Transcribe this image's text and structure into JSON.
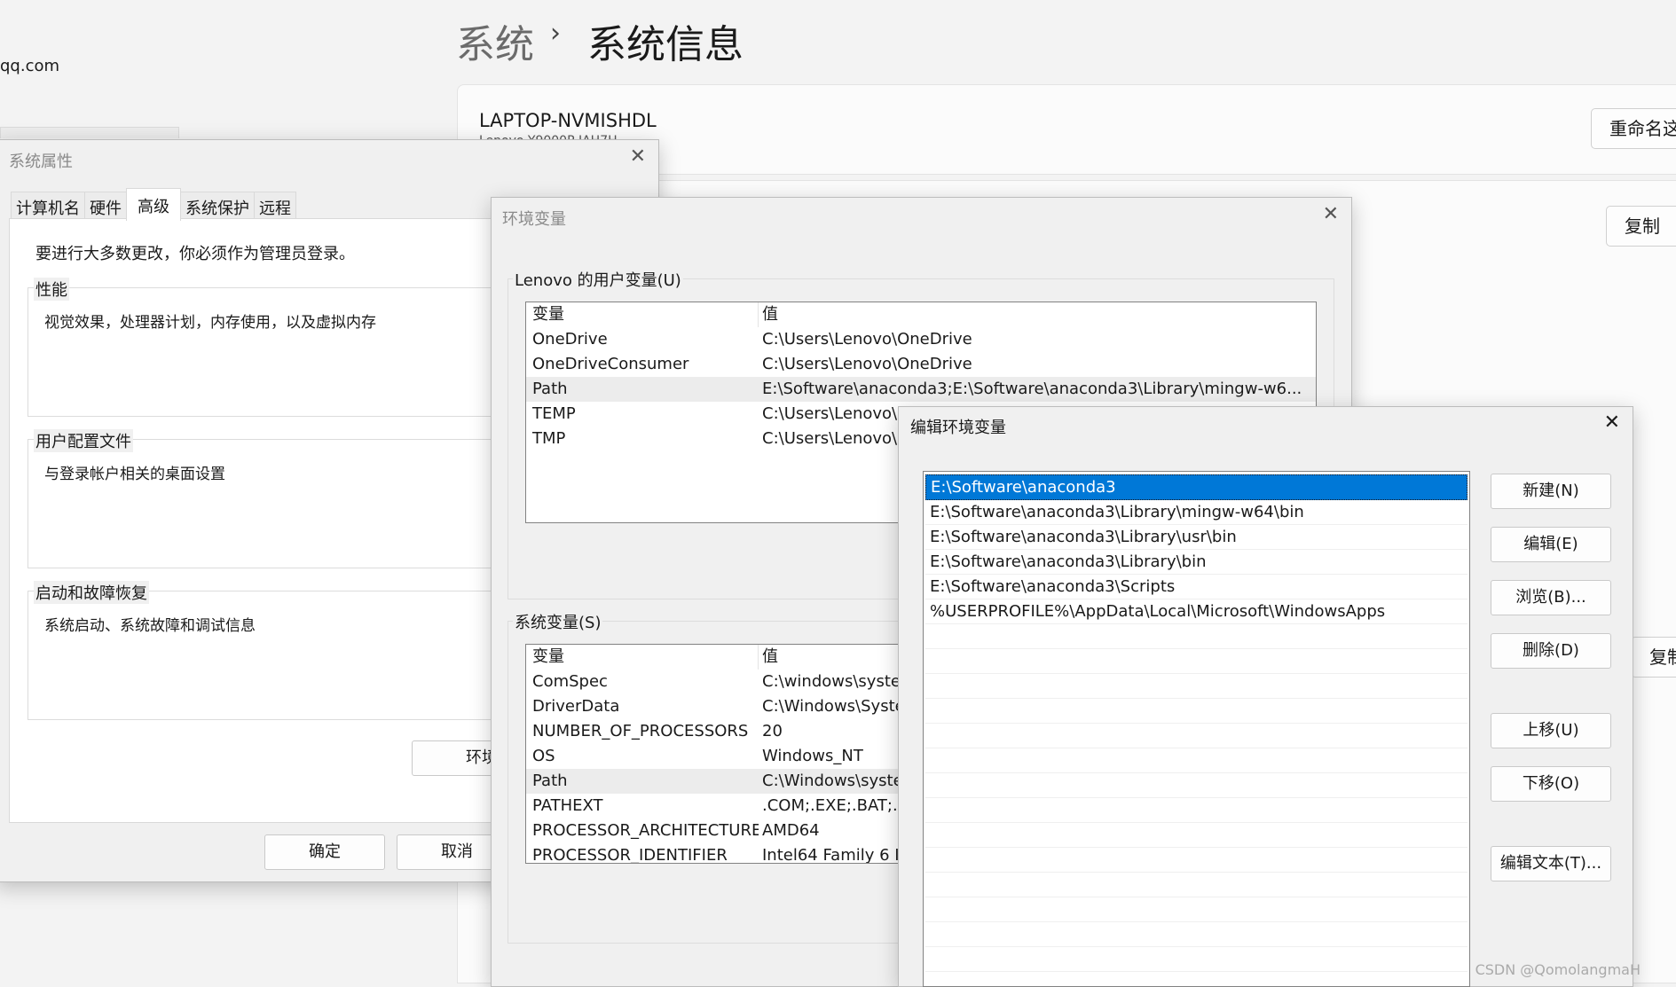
{
  "settings": {
    "breadcrumb_parent": "系统",
    "breadcrumb_sep": "›",
    "breadcrumb_current": "系统信息",
    "account_email": "qq.com",
    "device_name": "LAPTOP-NVMISHDL",
    "device_model": "Lenovo Y9000P IAH7H",
    "rename_button": "重命名这",
    "copy_button": "复制"
  },
  "sysprop": {
    "title": "系统属性",
    "tabs": [
      "计算机名",
      "硬件",
      "高级",
      "系统保护",
      "远程"
    ],
    "active_tab": "高级",
    "admin_notice": "要进行大多数更改，你必须作为管理员登录。",
    "performance": {
      "label": "性能",
      "desc": "视觉效果，处理器计划，内存使用，以及虚拟内存"
    },
    "profile": {
      "label": "用户配置文件",
      "desc": "与登录帐户相关的桌面设置"
    },
    "startup": {
      "label": "启动和故障恢复",
      "desc": "系统启动、系统故障和调试信息"
    },
    "envvars_button": "环境",
    "ok_button": "确定",
    "cancel_button": "取消"
  },
  "envvars": {
    "title": "环境变量",
    "user_group": "Lenovo 的用户变量(U)",
    "system_group": "系统变量(S)",
    "col_var": "变量",
    "col_val": "值",
    "user_vars": [
      {
        "name": "OneDrive",
        "value": "C:\\Users\\Lenovo\\OneDrive"
      },
      {
        "name": "OneDriveConsumer",
        "value": "C:\\Users\\Lenovo\\OneDrive"
      },
      {
        "name": "Path",
        "value": "E:\\Software\\anaconda3;E:\\Software\\anaconda3\\Library\\mingw-w6..."
      },
      {
        "name": "TEMP",
        "value": "C:\\Users\\Lenovo\\"
      },
      {
        "name": "TMP",
        "value": "C:\\Users\\Lenovo\\"
      }
    ],
    "system_vars": [
      {
        "name": "ComSpec",
        "value": "C:\\windows\\syste"
      },
      {
        "name": "DriverData",
        "value": "C:\\Windows\\Syste"
      },
      {
        "name": "NUMBER_OF_PROCESSORS",
        "value": "20"
      },
      {
        "name": "OS",
        "value": "Windows_NT"
      },
      {
        "name": "Path",
        "value": "C:\\Windows\\syste"
      },
      {
        "name": "PATHEXT",
        "value": ".COM;.EXE;.BAT;.C"
      },
      {
        "name": "PROCESSOR_ARCHITECTURE",
        "value": "AMD64"
      },
      {
        "name": "PROCESSOR_IDENTIFIER",
        "value": "Intel64 Family 6 I"
      }
    ]
  },
  "editenv": {
    "title": "编辑环境变量",
    "entries": [
      "E:\\Software\\anaconda3",
      "E:\\Software\\anaconda3\\Library\\mingw-w64\\bin",
      "E:\\Software\\anaconda3\\Library\\usr\\bin",
      "E:\\Software\\anaconda3\\Library\\bin",
      "E:\\Software\\anaconda3\\Scripts",
      "%USERPROFILE%\\AppData\\Local\\Microsoft\\WindowsApps"
    ],
    "buttons": {
      "new": "新建(N)",
      "edit": "编辑(E)",
      "browse": "浏览(B)...",
      "delete": "删除(D)",
      "up": "上移(U)",
      "down": "下移(O)",
      "edit_text": "编辑文本(T)..."
    }
  },
  "watermark": "CSDN @QomolangmaH",
  "colors": {
    "selection": "#0078d7",
    "dialog_bg": "#f0f0f0"
  }
}
